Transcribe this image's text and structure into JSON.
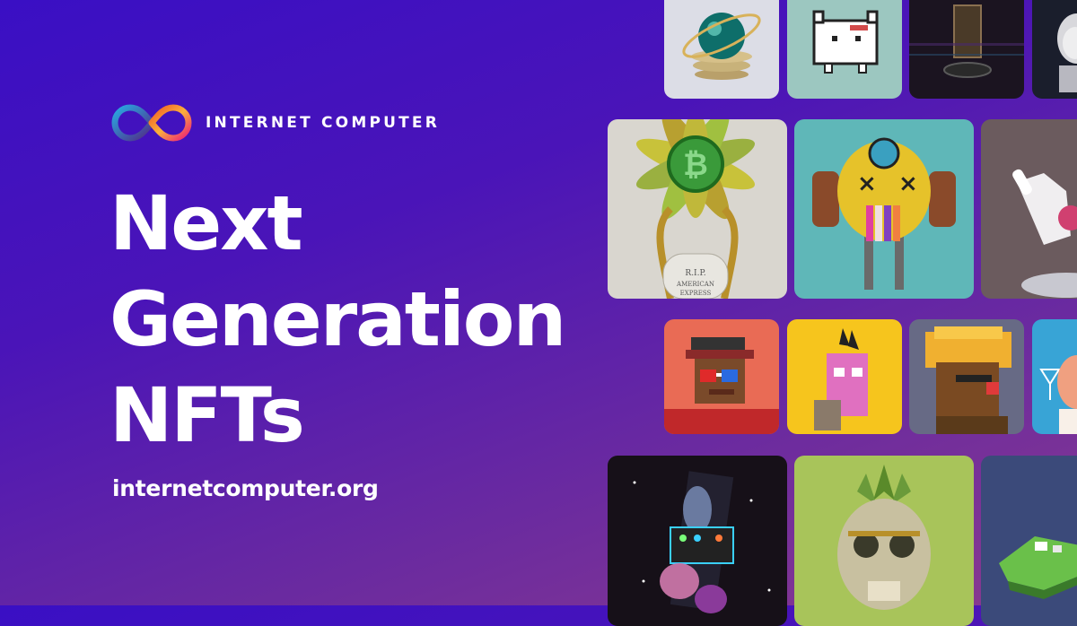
{
  "brand": {
    "name": "INTERNET COMPUTER",
    "logo_colors": [
      "#29abe2",
      "#522785",
      "#f15a24",
      "#fbb03b",
      "#ed1e79"
    ]
  },
  "headline": {
    "line1": "Next",
    "line2": "Generation",
    "line3": "NFTs"
  },
  "url": "internetcomputer.org",
  "gallery": {
    "tiles": [
      {
        "name": "nft-gold-sphere",
        "bg": "#dcdde6"
      },
      {
        "name": "nft-pixel-cat",
        "bg": "#9cc7c0"
      },
      {
        "name": "nft-dark-tablet",
        "bg": "#1b1420"
      },
      {
        "name": "nft-robot-bust",
        "bg": "#1a1e2c"
      },
      {
        "name": "nft-bitcoin-flower",
        "bg": "#d9d6cf"
      },
      {
        "name": "nft-yellow-robot",
        "bg": "#5fb7b8"
      },
      {
        "name": "nft-robot-hand",
        "bg": "#6b5b5e"
      },
      {
        "name": "nft-pixel-punk",
        "bg": "#e96b55"
      },
      {
        "name": "nft-pink-block",
        "bg": "#f6c51d"
      },
      {
        "name": "nft-pixel-monkey",
        "bg": "#676a85"
      },
      {
        "name": "nft-cocktail-character",
        "bg": "#38a4d6"
      },
      {
        "name": "nft-space-dino",
        "bg": "#161018"
      },
      {
        "name": "nft-green-skull",
        "bg": "#a8c45a"
      },
      {
        "name": "nft-voxel-island",
        "bg": "#3b4a7a"
      }
    ]
  }
}
